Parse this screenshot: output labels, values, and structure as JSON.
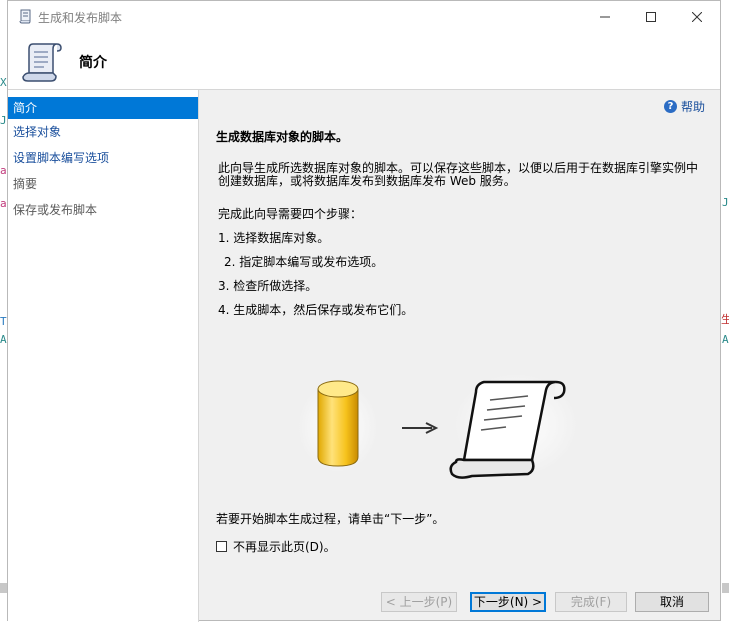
{
  "window": {
    "title": "生成和发布脚本"
  },
  "header": {
    "title": "简介"
  },
  "nav": {
    "items": [
      {
        "label": "简介",
        "state": "active"
      },
      {
        "label": "选择对象",
        "state": "link"
      },
      {
        "label": "设置脚本编写选项",
        "state": "link"
      },
      {
        "label": "摘要",
        "state": "dim"
      },
      {
        "label": "保存或发布脚本",
        "state": "dim"
      }
    ]
  },
  "content": {
    "help_label": "帮助",
    "title": "生成数据库对象的脚本。",
    "description": "此向导生成所选数据库对象的脚本。可以保存这些脚本，以便以后用于在数据库引擎实例中创建数据库，或将数据库发布到数据库发布 Web 服务。",
    "steps_label": "完成此向导需要四个步骤：",
    "steps": [
      "1.  选择数据库对象。",
      "2.  指定脚本编写或发布选项。",
      "3.  检查所做选择。",
      "4.  生成脚本，然后保存或发布它们。"
    ],
    "start_hint": "若要开始脚本生成过程，请单击“下一步”。",
    "dont_show_label": "不再显示此页(D)。",
    "dont_show_checked": false
  },
  "footer": {
    "prev_label": "< 上一步(P)",
    "next_label": "下一步(N) >",
    "finish_label": "完成(F)",
    "cancel_label": "取消"
  },
  "icons": {
    "title": "scroll-icon",
    "header": "scroll-icon",
    "help": "help-icon",
    "database": "database-icon",
    "arrow": "arrow-right-icon",
    "script": "scroll-icon"
  },
  "colors": {
    "selection": "#0078d7",
    "link": "#1a4f9c",
    "panel": "#f0f0f0"
  },
  "background_glyphs": [
    "X",
    "J",
    "a",
    "a",
    "T",
    "A",
    "J",
    "生",
    "A"
  ]
}
